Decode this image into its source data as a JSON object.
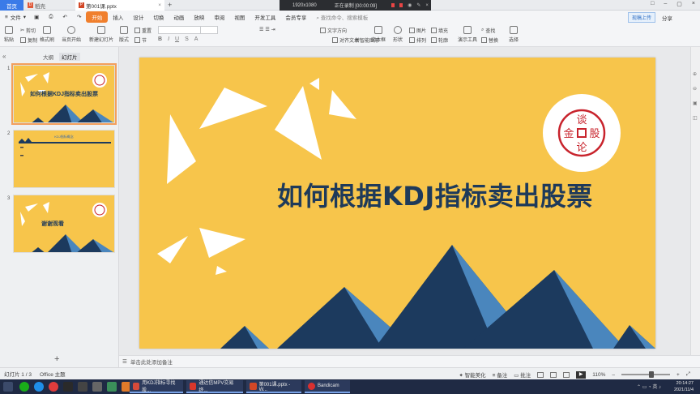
{
  "tabs": {
    "home": "首页",
    "draft": "稻壳",
    "doc": "第001课.pptx",
    "add": "+"
  },
  "recorder": {
    "resolution": "1920x1080",
    "status": "正在录制 [00:00:09]"
  },
  "menu": {
    "file": "文件",
    "items": [
      "开始",
      "插入",
      "设计",
      "切换",
      "动画",
      "放映",
      "审阅",
      "视图",
      "开发工具",
      "会员专享"
    ],
    "search": "查找命令、搜索模板",
    "upload": "现稿上传",
    "share": "分享"
  },
  "ribbon": {
    "paste": "粘贴",
    "cut": "剪切",
    "copy": "复制",
    "format_painter": "格式刷",
    "from_current": "当页开始",
    "new_slide": "新建幻灯片",
    "layout": "版式",
    "reset": "重置",
    "section": "节",
    "text_direction": "文字方向",
    "align_text": "对齐文本",
    "convert_smartart": "转智能图形",
    "textbox": "文本框",
    "shape": "形状",
    "picture": "图片",
    "arrange": "排列",
    "fill": "填充",
    "outline": "轮廓",
    "presenter_tools": "演示工具",
    "find": "查找",
    "replace": "替换",
    "select": "选择"
  },
  "left_panel": {
    "tab_outline": "大纲",
    "tab_slides": "幻灯片",
    "thumbnails": [
      {
        "num": "1",
        "title": "如何根据KDJ指标卖出股票"
      },
      {
        "num": "2",
        "title": "KDJ指标概念"
      },
      {
        "num": "3",
        "title": "谢谢观看"
      }
    ],
    "add_slide": "+"
  },
  "slide": {
    "title": "如何根据KDJ指标卖出股票",
    "seal_text": [
      "谈",
      "股",
      "论",
      "金"
    ]
  },
  "notes": {
    "placeholder": "单击此处添加备注"
  },
  "status": {
    "slide_count": "幻灯片 1 / 3",
    "theme": "Office 主题",
    "beautify": "智能美化",
    "notes": "备注",
    "comments": "批注",
    "zoom": "110%"
  },
  "taskbar": {
    "apps": [
      {
        "label": "用KDJ指标寻找股...",
        "color": "#d64a3a"
      },
      {
        "label": "通达信MPV交易终...",
        "color": "#d9372b"
      },
      {
        "label": "第001课.pptx - W...",
        "color": "#d24726"
      },
      {
        "label": "Bandicam",
        "color": "#d9302f"
      }
    ],
    "time": "20:14:27",
    "date": "2021/11/4"
  },
  "colors": {
    "slide_bg": "#f7c54b",
    "title_color": "#1e3a5a",
    "mountain_dark": "#1c3a5e",
    "mountain_light": "#4a86bd",
    "accent_tab": "#f07f2d",
    "seal_red": "#c8232c"
  }
}
